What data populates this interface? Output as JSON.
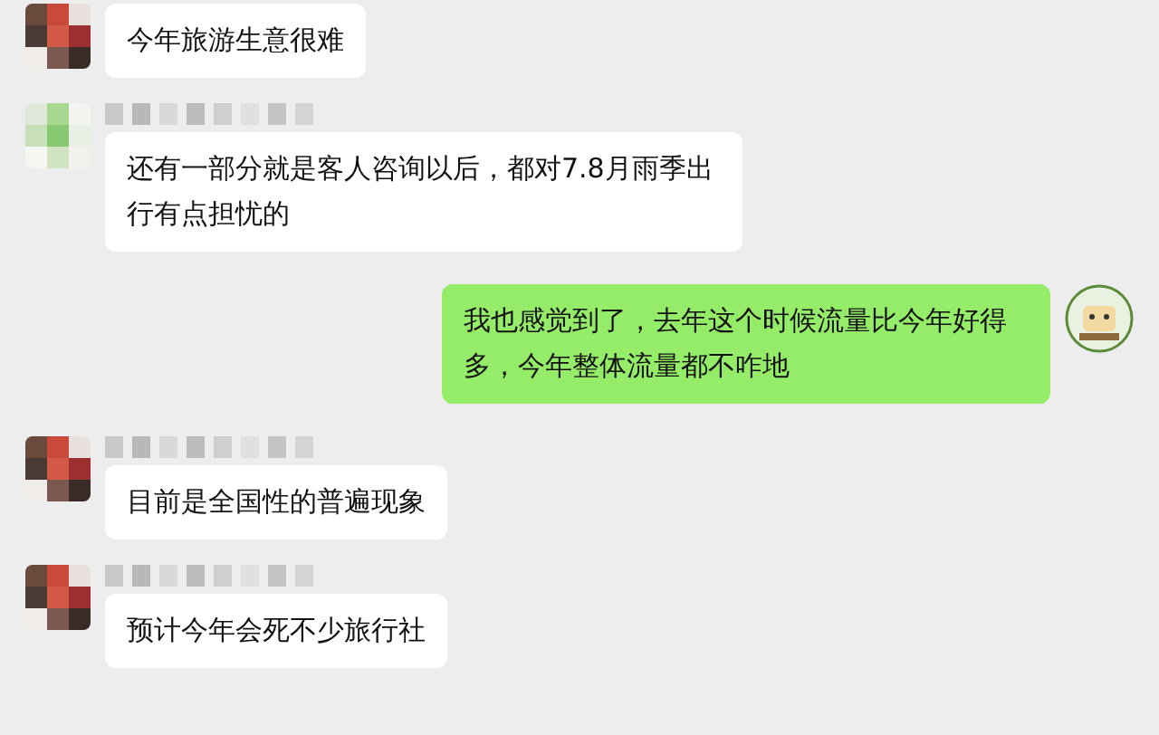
{
  "messages": [
    {
      "from_me": false,
      "name_blurred": false,
      "text": "今年旅游生意很难"
    },
    {
      "from_me": false,
      "name_blurred": true,
      "text": "还有一部分就是客人咨询以后，都对7.8月雨季出行有点担忧的"
    },
    {
      "from_me": true,
      "text": "我也感觉到了，去年这个时候流量比今年好得多，今年整体流量都不咋地"
    },
    {
      "from_me": false,
      "name_blurred": true,
      "text": "目前是全国性的普遍现象"
    },
    {
      "from_me": false,
      "name_blurred": true,
      "text": "预计今年会死不少旅行社"
    }
  ]
}
